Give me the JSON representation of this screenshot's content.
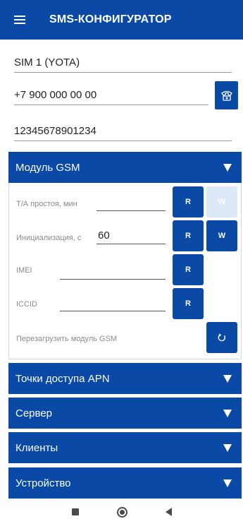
{
  "appbar": {
    "title": "SMS-КОНФИГУРАТОР"
  },
  "sim": {
    "name": "SIM 1 (YOTA)",
    "phone": "+7 900 000 00 00",
    "code": "12345678901234"
  },
  "gsm": {
    "title": "Модуль GSM",
    "idle_label": "Т/А простоя, мин",
    "idle_value": "",
    "init_label": "Инициализация, с",
    "init_value": "60",
    "imei_label": "IMEI",
    "imei_value": "",
    "iccid_label": "ICCID",
    "iccid_value": "",
    "reboot_label": "Перезагрузить модуль GSM",
    "read_label": "R",
    "write_label": "W"
  },
  "sections": [
    {
      "title": "Точки доступа APN"
    },
    {
      "title": "Сервер"
    },
    {
      "title": "Клиенты"
    },
    {
      "title": "Устройство"
    }
  ],
  "colors": {
    "primary": "#0a4aa6",
    "disabled_button": "#dde9f8"
  },
  "icons": {
    "menu": "hamburger-menu-icon",
    "phone": "telephone-icon",
    "expand": "caret-down-icon",
    "reboot": "refresh-icon",
    "nav": [
      "recent-apps-icon",
      "home-icon",
      "back-icon"
    ]
  }
}
